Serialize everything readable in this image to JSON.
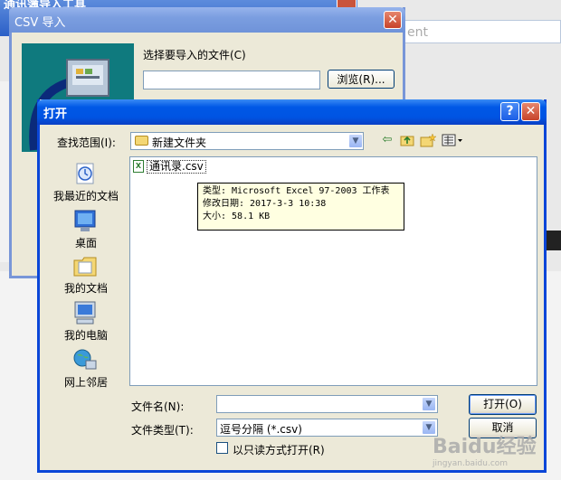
{
  "background": {
    "window_title": "通讯簿导入工具",
    "search_placeholder": "ent"
  },
  "csv_dialog": {
    "title": "CSV 导入",
    "close_glyph": "✕",
    "prompt_label": "选择要导入的文件(C)",
    "file_path_value": "",
    "browse_label": "浏览(R)..."
  },
  "open_dialog": {
    "title": "打开",
    "help_glyph": "?",
    "close_glyph": "✕",
    "look_in_label": "查找范围(I):",
    "look_in_value": "新建文件夹",
    "places": [
      {
        "label": "我最近的文档",
        "icon": "recent-documents-icon"
      },
      {
        "label": "桌面",
        "icon": "desktop-icon"
      },
      {
        "label": "我的文档",
        "icon": "my-documents-icon"
      },
      {
        "label": "我的电脑",
        "icon": "my-computer-icon"
      },
      {
        "label": "网上邻居",
        "icon": "network-places-icon"
      }
    ],
    "files": [
      {
        "name": "通讯录.csv",
        "icon": "excel-csv-file-icon"
      }
    ],
    "tooltip": {
      "type_line": "类型: Microsoft Excel 97-2003 工作表",
      "modified_line": "修改日期: 2017-3-3 10:38",
      "size_line": "大小: 58.1 KB"
    },
    "file_name_label": "文件名(N):",
    "file_name_value": "",
    "file_type_label": "文件类型(T):",
    "file_type_value": "逗号分隔 (*.csv)",
    "open_button": "打开(O)",
    "cancel_button": "取消",
    "read_only_label": "以只读方式打开(R)",
    "read_only_checked": false
  },
  "watermark": {
    "brand": "Baidu经验",
    "url": "jingyan.baidu.com"
  },
  "colors": {
    "xp_title_blue": "#0054e3",
    "dialog_face": "#ece9d8",
    "tooltip_bg": "#ffffe1",
    "close_red": "#c7432a"
  }
}
